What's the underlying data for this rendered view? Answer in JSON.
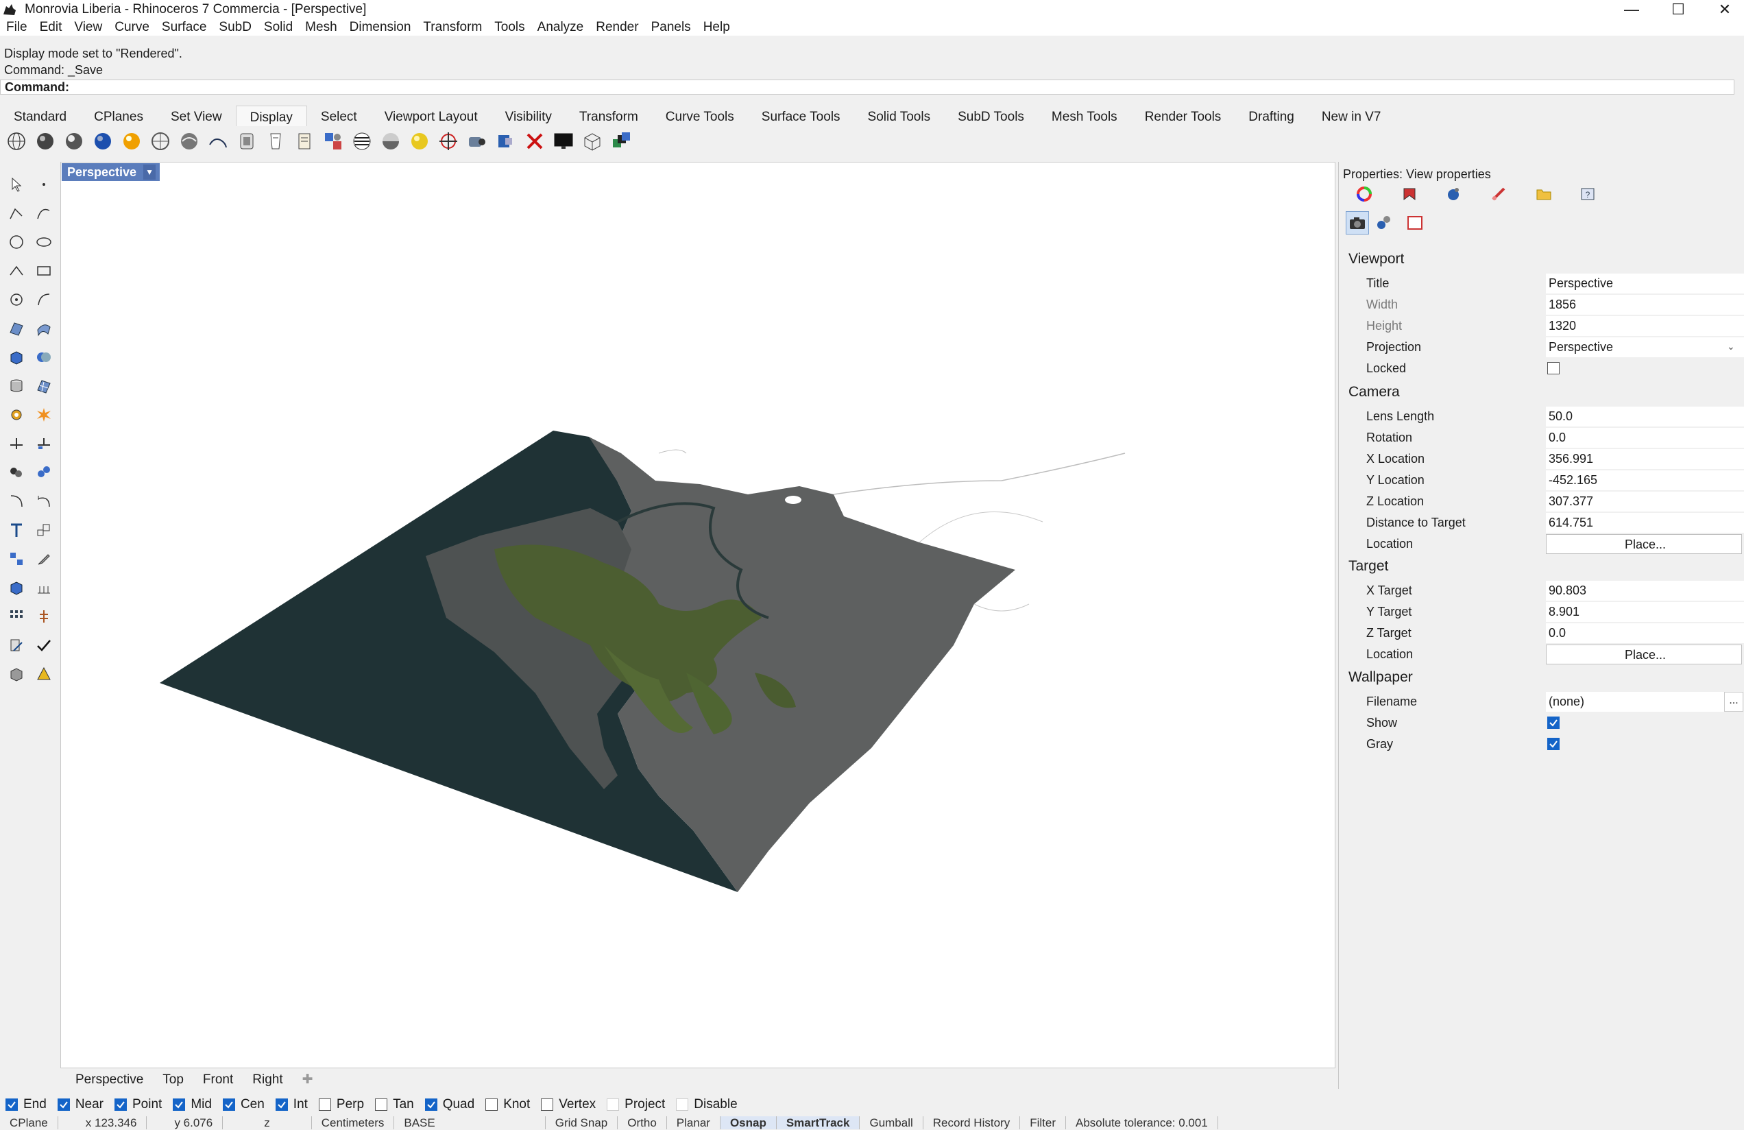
{
  "window": {
    "title": "Monrovia Liberia - Rhinoceros 7 Commercia - [Perspective]"
  },
  "menu": [
    "File",
    "Edit",
    "View",
    "Curve",
    "Surface",
    "SubD",
    "Solid",
    "Mesh",
    "Dimension",
    "Transform",
    "Tools",
    "Analyze",
    "Render",
    "Panels",
    "Help"
  ],
  "history": {
    "line1": "Display mode set to \"Rendered\".",
    "line2": "Command: _Save"
  },
  "command": {
    "label": "Command:"
  },
  "tabs": [
    "Standard",
    "CPlanes",
    "Set View",
    "Display",
    "Select",
    "Viewport Layout",
    "Visibility",
    "Transform",
    "Curve Tools",
    "Surface Tools",
    "Solid Tools",
    "SubD Tools",
    "Mesh Tools",
    "Render Tools",
    "Drafting",
    "New in V7"
  ],
  "active_tab": "Display",
  "toolbar_icons": [
    "wireframe-icon",
    "shaded-icon",
    "rendered-icon",
    "ghosted-icon",
    "xray-icon",
    "technical-icon",
    "artistic-icon",
    "pen-icon",
    "arctic-icon",
    "raytraced-icon",
    "monochrome-icon",
    "display-options-icon",
    "zebra-icon",
    "env-map-icon",
    "draft-angle-icon",
    "curvature-icon",
    "light-icon",
    "sun-icon",
    "camera-icon",
    "clipping-icon",
    "monitor-icon",
    "named-views-icon",
    "layers-icon"
  ],
  "viewport": {
    "name": "Perspective"
  },
  "view_tabs": [
    "Perspective",
    "Top",
    "Front",
    "Right"
  ],
  "osnaps": [
    {
      "label": "End",
      "checked": true
    },
    {
      "label": "Near",
      "checked": true
    },
    {
      "label": "Point",
      "checked": true
    },
    {
      "label": "Mid",
      "checked": true
    },
    {
      "label": "Cen",
      "checked": true
    },
    {
      "label": "Int",
      "checked": true
    },
    {
      "label": "Perp",
      "checked": false
    },
    {
      "label": "Tan",
      "checked": false
    },
    {
      "label": "Quad",
      "checked": true
    },
    {
      "label": "Knot",
      "checked": false
    },
    {
      "label": "Vertex",
      "checked": false
    },
    {
      "label": "Project",
      "checked": false
    },
    {
      "label": "Disable",
      "checked": false
    }
  ],
  "status": {
    "cplane": "CPlane",
    "x": "x 123.346",
    "y": "y 6.076",
    "z": "z",
    "units": "Centimeters",
    "layer": "BASE",
    "grid_snap": "Grid Snap",
    "ortho": "Ortho",
    "planar": "Planar",
    "osnap": "Osnap",
    "smarttrack": "SmartTrack",
    "gumball": "Gumball",
    "record_history": "Record History",
    "filter": "Filter",
    "tolerance": "Absolute tolerance: 0.001"
  },
  "props": {
    "title": "Properties: View properties",
    "viewport_section": "Viewport",
    "title_label": "Title",
    "title_value": "Perspective",
    "width_label": "Width",
    "width_value": "1856",
    "height_label": "Height",
    "height_value": "1320",
    "projection_label": "Projection",
    "projection_value": "Perspective",
    "locked_label": "Locked",
    "camera_section": "Camera",
    "lens_label": "Lens Length",
    "lens_value": "50.0",
    "rotation_label": "Rotation",
    "rotation_value": "0.0",
    "xloc_label": "X Location",
    "xloc_value": "356.991",
    "yloc_label": "Y Location",
    "yloc_value": "-452.165",
    "zloc_label": "Z Location",
    "zloc_value": "307.377",
    "dist_label": "Distance to Target",
    "dist_value": "614.751",
    "location_label": "Location",
    "place_label": "Place...",
    "target_section": "Target",
    "xt_label": "X Target",
    "xt_value": "90.803",
    "yt_label": "Y Target",
    "yt_value": "8.901",
    "zt_label": "Z Target",
    "zt_value": "0.0",
    "tlocation_label": "Location",
    "tplace_label": "Place...",
    "wallpaper_section": "Wallpaper",
    "filename_label": "Filename",
    "filename_value": "(none)",
    "show_label": "Show",
    "gray_label": "Gray"
  }
}
